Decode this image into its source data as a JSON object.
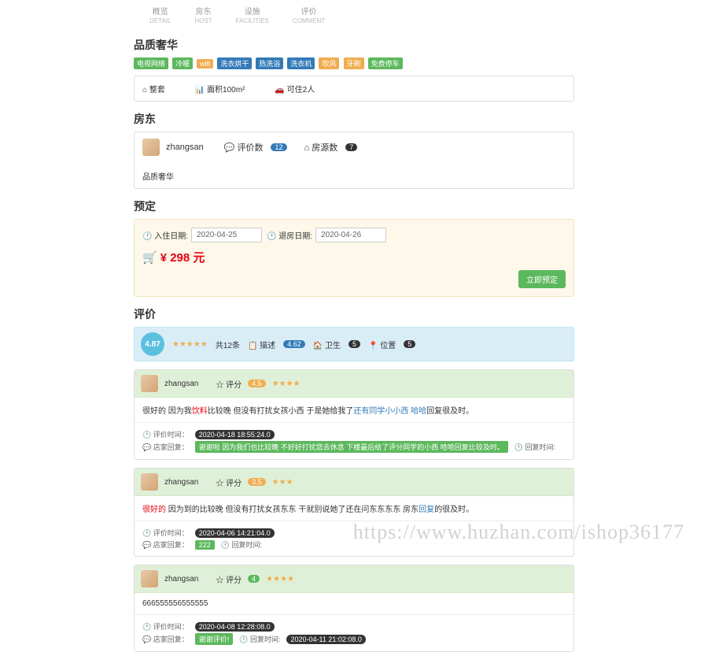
{
  "nav": {
    "tabs": [
      {
        "cn": "概览",
        "en": "DETAIL"
      },
      {
        "cn": "房东",
        "en": "HOST"
      },
      {
        "cn": "设施",
        "en": "FACILITIES"
      },
      {
        "cn": "评价",
        "en": "COMMENT"
      }
    ]
  },
  "title": "品质奢华",
  "amenity_tags": [
    "电视网络",
    "冷暖",
    "wifi",
    "洗衣烘干",
    "热洗浴",
    "洗衣机",
    "吹风",
    "牙刷",
    "免费停车"
  ],
  "info": {
    "type": "⌂ 整套",
    "area": "📊 面积100m²",
    "cap": "🚗 可住2人"
  },
  "landlord": {
    "heading": "房东",
    "name": "zhangsan",
    "rv_label": "💬 评价数",
    "rv_count": "12",
    "hs_label": "⌂ 房源数",
    "hs_count": "7",
    "desc": "品质奢华"
  },
  "booking": {
    "heading": "预定",
    "in_label": "🕐 入住日期:",
    "in_val": "2020-04-25",
    "out_label": "🕐 退房日期:",
    "out_val": "2020-04-26",
    "price_label": "¥ 298 元",
    "btn": "立即预定"
  },
  "ratings": {
    "heading": "评价",
    "score": "4.87",
    "total": "共12条",
    "desc_l": "📋 描述",
    "desc_v": "4.62",
    "hyg_l": "🏠 卫生",
    "hyg_v": "5",
    "loc_l": "📍 位置",
    "loc_v": "5"
  },
  "reviews": [
    {
      "user": "zhangsan",
      "score_l": "☆ 评分",
      "score": "4.5",
      "stars": "★★★★",
      "body_pre": "很好的 因为我",
      "body_hl1": "饮料",
      "body_mid": "比较晚 但没有打扰女孩小西 于是她给我了",
      "body_hl2": "还有同学小小西 哈哈",
      "body_end": "回复很及时。",
      "time_l": "🕐 评价时间：",
      "time": "2020-04-18 18:55:24.0",
      "resp_l": "💬 店家回复：",
      "resp": "谢谢啦 因为我们也比较晚 不好好打扰您去休息 下楼最后给了评分同学的小西 哈哈回复比较及时。",
      "rt_l": "🕐 回复时间:"
    },
    {
      "user": "zhangsan",
      "score_l": "☆ 评分",
      "score": "3.5",
      "stars": "★★★",
      "body_pre": "",
      "body_hl1": "很好的",
      "body_mid": " 因为到的比较晚 但没有打扰女孩东东 干就别说她了还在问东东东东 房东",
      "body_hl2": "回复",
      "body_end": "的很及时。",
      "time_l": "🕐 评价时间：",
      "time": "2020-04-06 14:21:04.0",
      "resp_l": "💬 店家回复：",
      "resp": "222",
      "rt_l": "🕐 回复时间:"
    },
    {
      "user": "zhangsan",
      "score_l": "☆ 评分",
      "score": "4",
      "stars": "★★★★",
      "body_pre": "666555556555555",
      "body_hl1": "",
      "body_mid": "",
      "body_hl2": "",
      "body_end": "",
      "time_l": "🕐 评价时间：",
      "time": "2020-04-08 12:28:08.0",
      "resp_l": "💬 店家回复：",
      "resp": "谢谢评价!",
      "rt_l": "🕐 回复时间:",
      "rt": "2020-04-11 21:02:08.0"
    }
  ],
  "watermark": "https://www.huzhan.com/ishop36177"
}
